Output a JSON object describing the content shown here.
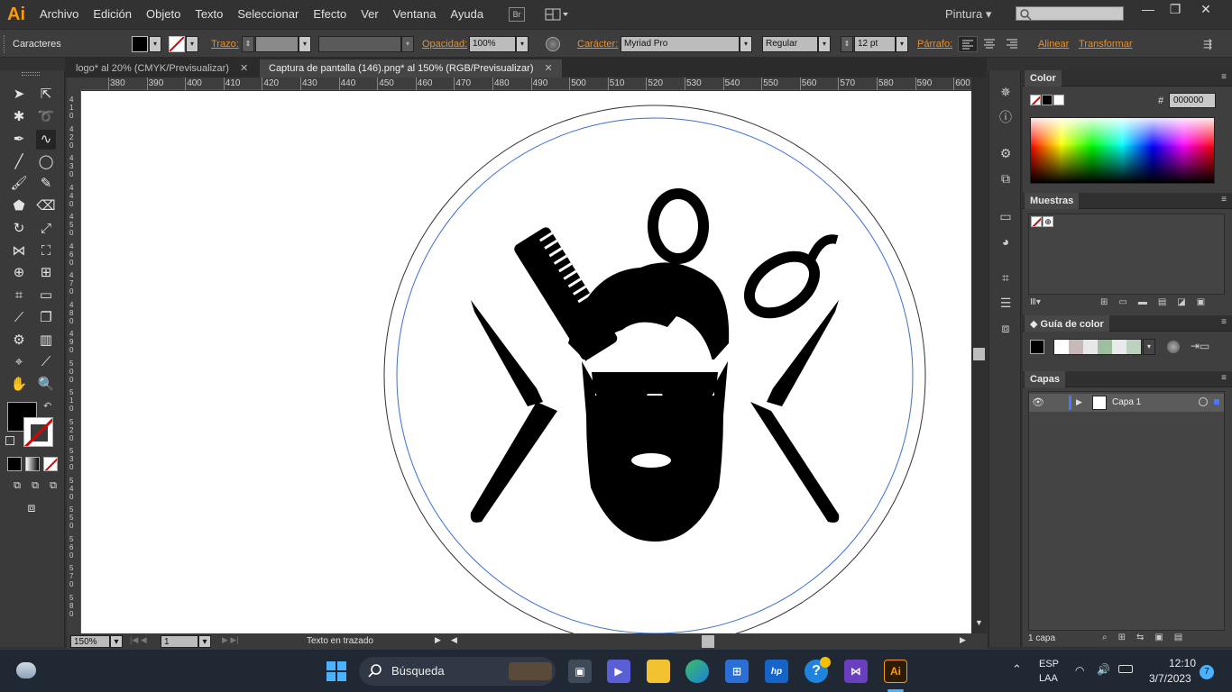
{
  "app": {
    "logo": "Ai",
    "brand_color": "#ff9a00"
  },
  "menu": [
    "Archivo",
    "Edición",
    "Objeto",
    "Texto",
    "Seleccionar",
    "Efecto",
    "Ver",
    "Ventana",
    "Ayuda"
  ],
  "bridge_label": "Br",
  "workspace": "Pintura",
  "window_controls": {
    "minimize": "—",
    "restore": "❐",
    "close": "✕"
  },
  "control_bar": {
    "panel_name": "Caracteres",
    "stroke_label": "Trazo:",
    "opacity_label": "Opacidad:",
    "opacity_value": "100%",
    "character_label": "Carácter:",
    "font_family": "Myriad Pro",
    "font_style": "Regular",
    "font_size": "12 pt",
    "paragraph_label": "Párrafo:",
    "align_label": "Alinear",
    "transform_label": "Transformar"
  },
  "tabs": [
    {
      "label": "logo* al 20% (CMYK/Previsualizar)",
      "close": "✕"
    },
    {
      "label": "Captura de pantalla (146).png* al 150% (RGB/Previsualizar)",
      "close": "✕"
    }
  ],
  "ruler_top": [
    "380",
    "390",
    "400",
    "410",
    "420",
    "430",
    "440",
    "450",
    "460",
    "470",
    "480",
    "490",
    "500",
    "510",
    "520",
    "530",
    "540",
    "550",
    "560",
    "570",
    "580",
    "590",
    "600"
  ],
  "ruler_left": [
    "4 1 0",
    "4 2 0",
    "4 3 0",
    "4 4 0",
    "4 5 0",
    "4 6 0",
    "4 7 0",
    "4 8 0",
    "4 9 0",
    "5 0 0",
    "5 1 0",
    "5 2 0",
    "5 3 0",
    "5 4 0",
    "5 5 0",
    "5 6 0",
    "5 7 0",
    "5 8 0"
  ],
  "status_bar": {
    "zoom": "150%",
    "page": "1",
    "tool_info": "Texto en trazado"
  },
  "panels": {
    "color": {
      "title": "Color",
      "hex_label": "#",
      "hex_value": "000000"
    },
    "swatches": {
      "title": "Muestras"
    },
    "color_guide": {
      "title": "Guía de color"
    },
    "layers": {
      "title": "Capas",
      "layer_name": "Capa 1",
      "layer_count": "1 capa"
    }
  },
  "taskbar": {
    "search_placeholder": "Búsqueda",
    "lang_top": "ESP",
    "lang_bottom": "LAA",
    "time": "12:10",
    "date": "3/7/2023",
    "notification_count": "7",
    "hp_label": "hp",
    "ai_label": "Ai"
  }
}
